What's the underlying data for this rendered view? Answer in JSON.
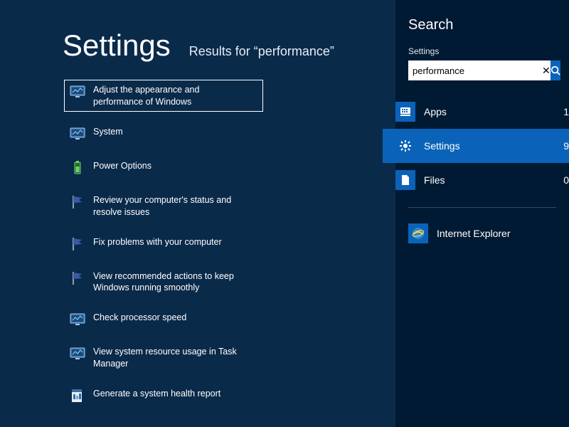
{
  "main": {
    "title": "Settings",
    "subtitle_prefix": "Results for “",
    "subtitle_term": "performance",
    "subtitle_suffix": "”",
    "results": [
      {
        "label": "Adjust the appearance and performance of Windows",
        "icon": "monitor-perf-icon",
        "selected": true
      },
      {
        "label": "System",
        "icon": "monitor-system-icon",
        "selected": false
      },
      {
        "label": "Power Options",
        "icon": "battery-icon",
        "selected": false
      },
      {
        "label": "Review your computer's status and resolve issues",
        "icon": "flag-icon",
        "selected": false
      },
      {
        "label": "Fix problems with your computer",
        "icon": "flag-icon",
        "selected": false
      },
      {
        "label": "View recommended actions to keep Windows running smoothly",
        "icon": "flag-icon",
        "selected": false
      },
      {
        "label": "Check processor speed",
        "icon": "monitor-perf-icon",
        "selected": false
      },
      {
        "label": "View system resource usage in Task Manager",
        "icon": "monitor-perf-icon",
        "selected": false
      },
      {
        "label": "Generate a system health report",
        "icon": "report-icon",
        "selected": false
      }
    ]
  },
  "sidebar": {
    "title": "Search",
    "context": "Settings",
    "search_value": "performance",
    "scopes": [
      {
        "label": "Apps",
        "count": 1,
        "icon": "apps-icon",
        "active": false
      },
      {
        "label": "Settings",
        "count": 9,
        "icon": "settings-icon",
        "active": true
      },
      {
        "label": "Files",
        "count": 0,
        "icon": "files-icon",
        "active": false
      }
    ],
    "apps": [
      {
        "label": "Internet Explorer",
        "icon": "ie-icon"
      }
    ]
  }
}
